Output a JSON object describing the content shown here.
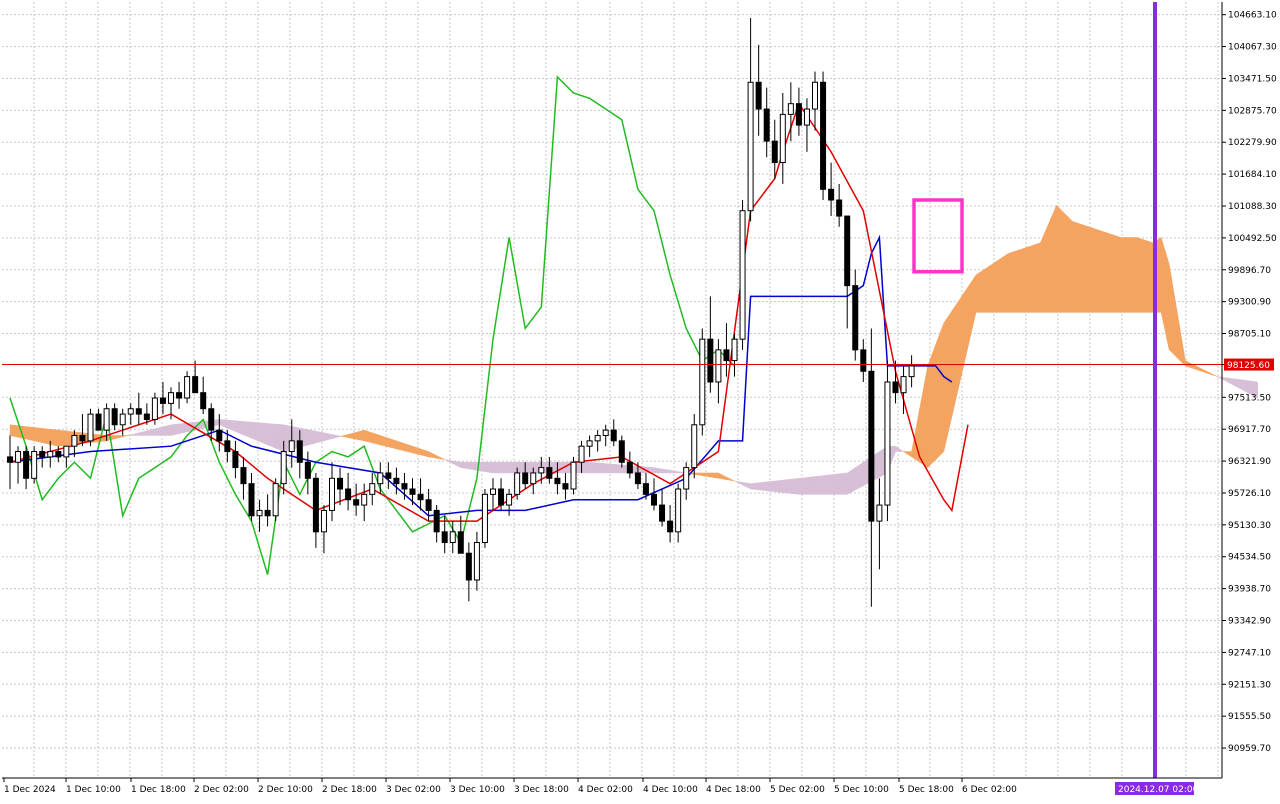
{
  "chart_data": {
    "type": "candlestick",
    "ylim": [
      90400,
      104900
    ],
    "y_ticks": [
      "104663.10",
      "104067.30",
      "103471.50",
      "102875.70",
      "102279.90",
      "101684.10",
      "101088.30",
      "100492.50",
      "99896.70",
      "99300.90",
      "98705.10",
      "98125.60",
      "97513.50",
      "96917.70",
      "96321.90",
      "95726.10",
      "95130.30",
      "94534.50",
      "93938.70",
      "93342.90",
      "92747.10",
      "92151.30",
      "91555.50",
      "90959.70"
    ],
    "x_labels": [
      "1 Dec 2024",
      "1 Dec 10:00",
      "1 Dec 18:00",
      "2 Dec 02:00",
      "2 Dec 10:00",
      "2 Dec 18:00",
      "3 Dec 02:00",
      "3 Dec 10:00",
      "3 Dec 18:00",
      "4 Dec 02:00",
      "4 Dec 10:00",
      "4 Dec 18:00",
      "5 Dec 02:00",
      "5 Dec 10:00",
      "5 Dec 18:00",
      "6 Dec 02:00"
    ],
    "current_price_label": "98125.60",
    "future_time_label": "2024.12.07 02:00",
    "grid": true,
    "colors": {
      "bull_candle": "#ffffff",
      "bear_candle": "#000000",
      "tenkan": "#e00000",
      "kijun": "#0000d0",
      "chikou": "#22bb22",
      "kumo_bull": "#f4a460",
      "kumo_bear": "#d8bfd8",
      "price_line": "#e00000",
      "vertical_marker": "#8a2be2",
      "highlight_box": "#ff33cc"
    },
    "candles": [
      [
        96400,
        96800,
        95800,
        96300
      ],
      [
        96300,
        96600,
        95900,
        96500
      ],
      [
        96500,
        96600,
        95800,
        96000
      ],
      [
        96000,
        96600,
        95900,
        96500
      ],
      [
        96500,
        96600,
        96200,
        96400
      ],
      [
        96400,
        96700,
        96200,
        96500
      ],
      [
        96500,
        96600,
        96300,
        96400
      ],
      [
        96400,
        96600,
        96200,
        96600
      ],
      [
        96600,
        96900,
        96400,
        96800
      ],
      [
        96800,
        97200,
        96600,
        96700
      ],
      [
        96700,
        97300,
        96600,
        97200
      ],
      [
        97200,
        97300,
        96900,
        96900
      ],
      [
        96900,
        97400,
        96700,
        97300
      ],
      [
        97300,
        97400,
        96900,
        97000
      ],
      [
        97000,
        97300,
        96800,
        97200
      ],
      [
        97200,
        97400,
        97000,
        97300
      ],
      [
        97300,
        97600,
        97000,
        97200
      ],
      [
        97200,
        97400,
        97000,
        97100
      ],
      [
        97100,
        97600,
        97000,
        97500
      ],
      [
        97500,
        97800,
        97200,
        97400
      ],
      [
        97400,
        97700,
        97100,
        97600
      ],
      [
        97600,
        97800,
        97300,
        97500
      ],
      [
        97500,
        98000,
        97400,
        97900
      ],
      [
        97900,
        98200,
        97600,
        97600
      ],
      [
        97600,
        97900,
        97200,
        97300
      ],
      [
        97300,
        97400,
        96700,
        96900
      ],
      [
        96900,
        97200,
        96500,
        96700
      ],
      [
        96700,
        96900,
        96300,
        96500
      ],
      [
        96500,
        96700,
        96000,
        96200
      ],
      [
        96200,
        96400,
        95600,
        95900
      ],
      [
        95900,
        96100,
        95200,
        95300
      ],
      [
        95300,
        95600,
        95000,
        95400
      ],
      [
        95400,
        95700,
        95100,
        95300
      ],
      [
        95300,
        96000,
        95200,
        95900
      ],
      [
        95900,
        96700,
        95700,
        96500
      ],
      [
        96500,
        97100,
        96200,
        96700
      ],
      [
        96700,
        96900,
        96000,
        96300
      ],
      [
        96300,
        96500,
        95700,
        96000
      ],
      [
        96000,
        96100,
        94700,
        95000
      ],
      [
        95000,
        95500,
        94600,
        95400
      ],
      [
        95400,
        96300,
        95200,
        96000
      ],
      [
        96000,
        96200,
        95500,
        95800
      ],
      [
        95800,
        96100,
        95400,
        95600
      ],
      [
        95600,
        95900,
        95300,
        95500
      ],
      [
        95500,
        95900,
        95200,
        95700
      ],
      [
        95700,
        96100,
        95500,
        95900
      ],
      [
        95900,
        96300,
        95700,
        96100
      ],
      [
        96100,
        96300,
        95800,
        96000
      ],
      [
        96000,
        96200,
        95700,
        95900
      ],
      [
        95900,
        96100,
        95600,
        95800
      ],
      [
        95800,
        96000,
        95500,
        95700
      ],
      [
        95700,
        96000,
        95400,
        95600
      ],
      [
        95600,
        95800,
        95200,
        95400
      ],
      [
        95400,
        95500,
        94800,
        95000
      ],
      [
        95000,
        95300,
        94600,
        94800
      ],
      [
        94800,
        95200,
        94600,
        95000
      ],
      [
        95000,
        95300,
        94700,
        94600
      ],
      [
        94600,
        94800,
        93700,
        94100
      ],
      [
        94100,
        95000,
        93900,
        94800
      ],
      [
        94800,
        95800,
        94700,
        95700
      ],
      [
        95700,
        96000,
        95400,
        95800
      ],
      [
        95800,
        96000,
        95400,
        95500
      ],
      [
        95500,
        95800,
        95300,
        95700
      ],
      [
        95700,
        96200,
        95600,
        96100
      ],
      [
        96100,
        96300,
        95800,
        95900
      ],
      [
        95900,
        96200,
        95700,
        96100
      ],
      [
        96100,
        96400,
        95900,
        96200
      ],
      [
        96200,
        96400,
        95900,
        96000
      ],
      [
        96000,
        96300,
        95700,
        95900
      ],
      [
        95900,
        96100,
        95600,
        95800
      ],
      [
        95800,
        96400,
        95700,
        96300
      ],
      [
        96300,
        96700,
        96100,
        96600
      ],
      [
        96600,
        96800,
        96400,
        96700
      ],
      [
        96700,
        96900,
        96500,
        96800
      ],
      [
        96800,
        97000,
        96600,
        96900
      ],
      [
        96900,
        97100,
        96600,
        96700
      ],
      [
        96700,
        96800,
        96200,
        96300
      ],
      [
        96300,
        96500,
        96000,
        96100
      ],
      [
        96100,
        96300,
        95800,
        95900
      ],
      [
        95900,
        96100,
        95600,
        95700
      ],
      [
        95700,
        96000,
        95400,
        95500
      ],
      [
        95500,
        95800,
        95100,
        95200
      ],
      [
        95200,
        95500,
        94800,
        95000
      ],
      [
        95000,
        95900,
        94800,
        95800
      ],
      [
        95800,
        96300,
        95600,
        96200
      ],
      [
        96200,
        97200,
        96000,
        97000
      ],
      [
        97000,
        98800,
        96800,
        98600
      ],
      [
        98600,
        99400,
        97600,
        97800
      ],
      [
        97800,
        98600,
        97400,
        98400
      ],
      [
        98400,
        98900,
        97900,
        98200
      ],
      [
        98200,
        98700,
        97900,
        98600
      ],
      [
        98600,
        101200,
        98400,
        101000
      ],
      [
        101000,
        104600,
        100800,
        103400
      ],
      [
        103400,
        104100,
        102400,
        102900
      ],
      [
        102900,
        103300,
        102000,
        102300
      ],
      [
        102300,
        102700,
        101600,
        101900
      ],
      [
        101900,
        103200,
        101500,
        102800
      ],
      [
        102800,
        103400,
        102300,
        103000
      ],
      [
        103000,
        103300,
        102400,
        102600
      ],
      [
        102600,
        103100,
        102100,
        102900
      ],
      [
        102900,
        103600,
        102500,
        103400
      ],
      [
        103400,
        103600,
        101200,
        101400
      ],
      [
        101400,
        101900,
        100900,
        101200
      ],
      [
        101200,
        101500,
        100700,
        100900
      ],
      [
        100900,
        100900,
        98800,
        99600
      ],
      [
        99600,
        99900,
        98200,
        98400
      ],
      [
        98400,
        98600,
        97800,
        98000
      ],
      [
        98000,
        98800,
        93600,
        95200
      ],
      [
        95200,
        96000,
        94300,
        95500
      ],
      [
        95500,
        98200,
        95200,
        97800
      ],
      [
        97800,
        98200,
        97400,
        97600
      ],
      [
        97600,
        98100,
        97200,
        97900
      ],
      [
        97900,
        98300,
        97700,
        98100
      ]
    ],
    "tenkan": [
      [
        0,
        96300
      ],
      [
        10,
        96700
      ],
      [
        20,
        97200
      ],
      [
        28,
        96500
      ],
      [
        32,
        96000
      ],
      [
        38,
        95400
      ],
      [
        45,
        95800
      ],
      [
        52,
        95200
      ],
      [
        58,
        95200
      ],
      [
        65,
        95900
      ],
      [
        70,
        96300
      ],
      [
        76,
        96400
      ],
      [
        82,
        95900
      ],
      [
        88,
        96500
      ],
      [
        92,
        101000
      ],
      [
        95,
        101600
      ],
      [
        96,
        102100
      ],
      [
        98,
        103000
      ],
      [
        102,
        102100
      ],
      [
        106,
        101000
      ],
      [
        110,
        98000
      ],
      [
        113,
        96400
      ],
      [
        116,
        95600
      ],
      [
        117,
        95400
      ],
      [
        119,
        97000
      ]
    ],
    "kijun": [
      [
        0,
        96300
      ],
      [
        10,
        96500
      ],
      [
        20,
        96600
      ],
      [
        26,
        96900
      ],
      [
        30,
        96600
      ],
      [
        38,
        96300
      ],
      [
        46,
        96100
      ],
      [
        52,
        95300
      ],
      [
        58,
        95400
      ],
      [
        64,
        95400
      ],
      [
        70,
        95600
      ],
      [
        78,
        95600
      ],
      [
        84,
        96000
      ],
      [
        88,
        96700
      ],
      [
        91,
        96700
      ],
      [
        92,
        99400
      ],
      [
        104,
        99400
      ],
      [
        106,
        99600
      ],
      [
        107,
        100200
      ],
      [
        108,
        100500
      ],
      [
        109,
        98100
      ],
      [
        114,
        98100
      ],
      [
        115,
        98100
      ],
      [
        116,
        97900
      ],
      [
        117,
        97800
      ]
    ],
    "chikou": [
      [
        0,
        97500
      ],
      [
        2,
        96600
      ],
      [
        4,
        95600
      ],
      [
        6,
        96000
      ],
      [
        8,
        96300
      ],
      [
        10,
        96000
      ],
      [
        12,
        97200
      ],
      [
        14,
        95300
      ],
      [
        16,
        96000
      ],
      [
        18,
        96200
      ],
      [
        20,
        96400
      ],
      [
        22,
        96800
      ],
      [
        24,
        97100
      ],
      [
        26,
        96300
      ],
      [
        28,
        95700
      ],
      [
        30,
        95200
      ],
      [
        32,
        94200
      ],
      [
        34,
        96300
      ],
      [
        36,
        95700
      ],
      [
        38,
        96300
      ],
      [
        40,
        96500
      ],
      [
        42,
        96400
      ],
      [
        44,
        96600
      ],
      [
        46,
        95800
      ],
      [
        50,
        95000
      ],
      [
        54,
        95300
      ],
      [
        56,
        94800
      ],
      [
        58,
        96000
      ],
      [
        60,
        98600
      ],
      [
        62,
        100500
      ],
      [
        64,
        98800
      ],
      [
        66,
        99200
      ],
      [
        68,
        103500
      ],
      [
        70,
        103200
      ],
      [
        72,
        103100
      ],
      [
        74,
        102900
      ],
      [
        76,
        102700
      ],
      [
        78,
        101400
      ],
      [
        80,
        101000
      ],
      [
        82,
        99800
      ],
      [
        84,
        98800
      ],
      [
        86,
        98200
      ],
      [
        88,
        98400
      ],
      [
        90,
        98100
      ]
    ],
    "span_a": [
      [
        0,
        97000
      ],
      [
        6,
        96900
      ],
      [
        12,
        96800
      ],
      [
        20,
        96800
      ],
      [
        26,
        97000
      ],
      [
        34,
        96500
      ],
      [
        44,
        96900
      ],
      [
        52,
        96500
      ],
      [
        56,
        96200
      ],
      [
        60,
        96100
      ],
      [
        66,
        96100
      ],
      [
        72,
        96100
      ],
      [
        80,
        96100
      ],
      [
        88,
        96100
      ],
      [
        92,
        95800
      ],
      [
        98,
        95700
      ],
      [
        104,
        95700
      ],
      [
        109,
        96100
      ],
      [
        110,
        96500
      ],
      [
        112,
        96500
      ],
      [
        114,
        98100
      ],
      [
        116,
        98900
      ],
      [
        120,
        99800
      ],
      [
        124,
        100200
      ],
      [
        128,
        100400
      ],
      [
        130,
        101100
      ],
      [
        132,
        100800
      ],
      [
        138,
        100500
      ],
      [
        140,
        100500
      ],
      [
        142,
        100400
      ],
      [
        143,
        100500
      ],
      [
        144,
        100000
      ],
      [
        146,
        98200
      ],
      [
        150,
        97900
      ],
      [
        155,
        97500
      ]
    ],
    "span_b": [
      [
        0,
        96800
      ],
      [
        6,
        96600
      ],
      [
        12,
        96700
      ],
      [
        20,
        97000
      ],
      [
        26,
        97100
      ],
      [
        34,
        97000
      ],
      [
        44,
        96700
      ],
      [
        52,
        96400
      ],
      [
        56,
        96300
      ],
      [
        60,
        96300
      ],
      [
        66,
        96300
      ],
      [
        72,
        96300
      ],
      [
        80,
        96200
      ],
      [
        88,
        96000
      ],
      [
        92,
        95900
      ],
      [
        98,
        96000
      ],
      [
        104,
        96100
      ],
      [
        109,
        96600
      ],
      [
        110,
        96600
      ],
      [
        112,
        96400
      ],
      [
        114,
        96200
      ],
      [
        116,
        96500
      ],
      [
        120,
        99100
      ],
      [
        124,
        99100
      ],
      [
        128,
        99100
      ],
      [
        130,
        99100
      ],
      [
        132,
        99100
      ],
      [
        138,
        99100
      ],
      [
        140,
        99100
      ],
      [
        142,
        99100
      ],
      [
        143,
        99100
      ],
      [
        144,
        98400
      ],
      [
        146,
        98100
      ],
      [
        150,
        97900
      ],
      [
        155,
        97800
      ]
    ]
  }
}
